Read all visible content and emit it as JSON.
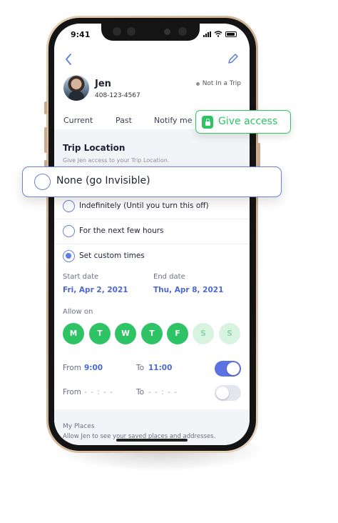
{
  "status_bar": {
    "time": "9:41"
  },
  "profile": {
    "name": "Jen",
    "phone": "408-123-4567",
    "trip_status": "Not In a Trip"
  },
  "tabs": [
    {
      "label": "Current"
    },
    {
      "label": "Past"
    },
    {
      "label": "Notify me"
    }
  ],
  "give_access": {
    "label": "Give access"
  },
  "trip_location": {
    "title": "Trip Location",
    "subtitle": "Give Jen access to your Trip Location."
  },
  "options": {
    "none": {
      "label": "None (go Invisible)",
      "selected": false
    },
    "indefinitely": {
      "label": "Indefinitely (Until you turn this off)",
      "selected": false
    },
    "next_hours": {
      "label": "For the next few hours",
      "selected": false
    },
    "custom": {
      "label": "Set custom times",
      "selected": true
    }
  },
  "dates": {
    "start_label": "Start date",
    "start_value": "Fri, Apr 2, 2021",
    "end_label": "End date",
    "end_value": "Thu, Apr 8, 2021"
  },
  "allow_on": {
    "label": "Allow on",
    "days": [
      {
        "label": "M",
        "enabled": true
      },
      {
        "label": "T",
        "enabled": true
      },
      {
        "label": "W",
        "enabled": true
      },
      {
        "label": "T",
        "enabled": true
      },
      {
        "label": "F",
        "enabled": true
      },
      {
        "label": "S",
        "enabled": false
      },
      {
        "label": "S",
        "enabled": false
      }
    ]
  },
  "time_ranges": [
    {
      "from_label": "From",
      "from_value": "9:00",
      "to_label": "To",
      "to_value": "11:00",
      "enabled": true
    },
    {
      "from_label": "From",
      "from_value": "- - : - -",
      "to_label": "To",
      "to_value": "- - : - -",
      "enabled": false
    }
  ],
  "my_places": {
    "title": "My Places",
    "subtitle": "Allow Jen to see your saved places and addresses."
  },
  "colors": {
    "accent_blue": "#5b7fe0",
    "accent_green": "#2ec466",
    "phone_frame": "#c9a98a"
  }
}
